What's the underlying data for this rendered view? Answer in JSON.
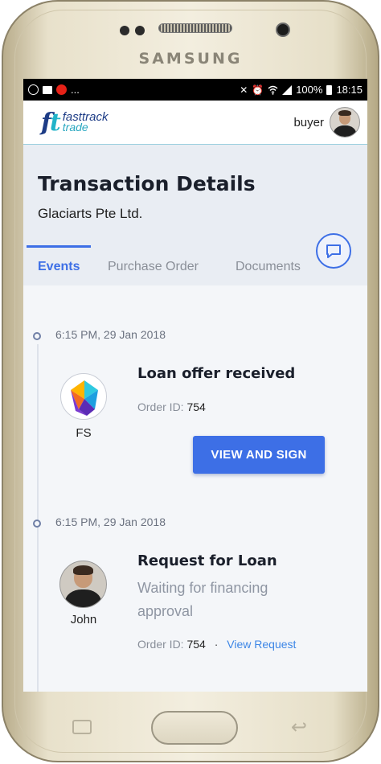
{
  "device": {
    "brand": "SAMSUNG"
  },
  "statusbar": {
    "left_extra": "...",
    "battery": "100%",
    "time": "18:15"
  },
  "appbar": {
    "logo_mark_f": "f",
    "logo_mark_t": "t",
    "logo_line1": "fasttrack",
    "logo_line2": "trade",
    "user_role": "buyer"
  },
  "header": {
    "title": "Transaction Details",
    "subtitle": "Glaciarts Pte Ltd.",
    "tabs": [
      {
        "label": "Events",
        "active": true
      },
      {
        "label": "Purchase Order",
        "active": false
      },
      {
        "label": "Documents",
        "active": false
      }
    ]
  },
  "events": [
    {
      "time": "6:15 PM, 29 Jan 2018",
      "party": "FS",
      "title": "Loan offer received",
      "order_label": "Order ID:",
      "order_id": "754",
      "action": "VIEW AND SIGN"
    },
    {
      "time": "6:15 PM, 29 Jan 2018",
      "party": "John",
      "title": "Request for Loan",
      "description": "Waiting for financing approval",
      "order_label": "Order ID:",
      "order_id": "754",
      "separator": "·",
      "link": "View Request"
    }
  ],
  "colors": {
    "accent": "#3d6fe6",
    "link": "#3d86e6",
    "brand_navy": "#1d3c86",
    "brand_teal": "#21b3c9"
  },
  "icons": [
    "chat-icon",
    "wifi-icon",
    "signal-icon",
    "battery-icon",
    "mute-icon",
    "alarm-icon",
    "gallery-icon",
    "youtube-icon"
  ]
}
